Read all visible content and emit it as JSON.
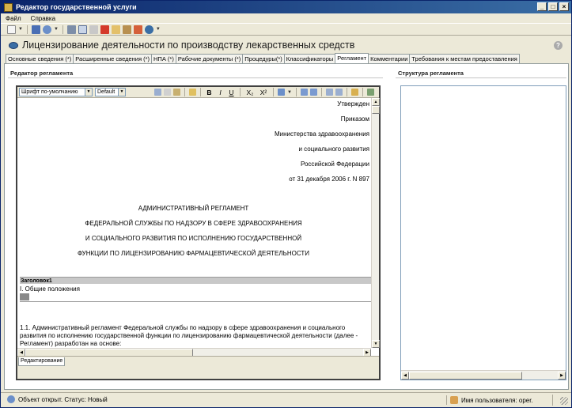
{
  "window": {
    "title": "Редактор государственной услуги",
    "buttons": [
      "_",
      "□",
      "×"
    ]
  },
  "menu": [
    "Файл",
    "Справка"
  ],
  "header": {
    "title": "Лицензирование деятельности по производству лекарственных средств",
    "help": "?"
  },
  "tabs": [
    "Основные сведения (*)",
    "Расширенные сведения (*)",
    "НПА (*)",
    "Рабочие документы (*)",
    "Процедуры(*)",
    "Классификаторы",
    "Регламент",
    "Комментарии",
    "Требования к местам предоставления"
  ],
  "editor": {
    "panel_title": "Редактор регламента",
    "font_combo": "Шрифт по-умолчанию",
    "size_combo": "Default",
    "fmt_bold": "B",
    "fmt_italic": "I",
    "fmt_underline": "U",
    "fmt_sub": "X₂",
    "fmt_sup": "X²",
    "approval": [
      "Утвержден",
      "Приказом",
      "Министерства здравоохранения",
      "и социального развития",
      "Российской Федерации",
      "от 31 декабря 2006 г. N 897"
    ],
    "heading": [
      "АДМИНИСТРАТИВНЫЙ РЕГЛАМЕНТ",
      "ФЕДЕРАЛЬНОЙ СЛУЖБЫ ПО НАДЗОРУ В СФЕРЕ ЗДРАВООХРАНЕНИЯ",
      "И СОЦИАЛЬНОГО РАЗВИТИЯ ПО ИСПОЛНЕНИЮ ГОСУДАРСТВЕННОЙ",
      "ФУНКЦИИ ПО ЛИЦЕНЗИРОВАНИЮ ФАРМАЦЕВТИЧЕСКОЙ ДЕЯТЕЛЬНОСТИ"
    ],
    "section_label": "Заголовок1",
    "section_title": "I. Общие положения",
    "paragraph": "1.1. Административный регламент Федеральной службы по надзору в сфере здравоохранения и социального развития по исполнению государственной функции по лицензированию фармацевтической деятельности (далее - Регламент) разработан на основе:",
    "bottom_tab": "Редактирование"
  },
  "structure": {
    "panel_title": "Структура регламента"
  },
  "status": {
    "left": "Объект открыт. Статус: Новый",
    "user": "Имя пользователя: oper."
  },
  "colors": {
    "titlebar": "#0a246a",
    "accent": "#3a6ea5"
  }
}
